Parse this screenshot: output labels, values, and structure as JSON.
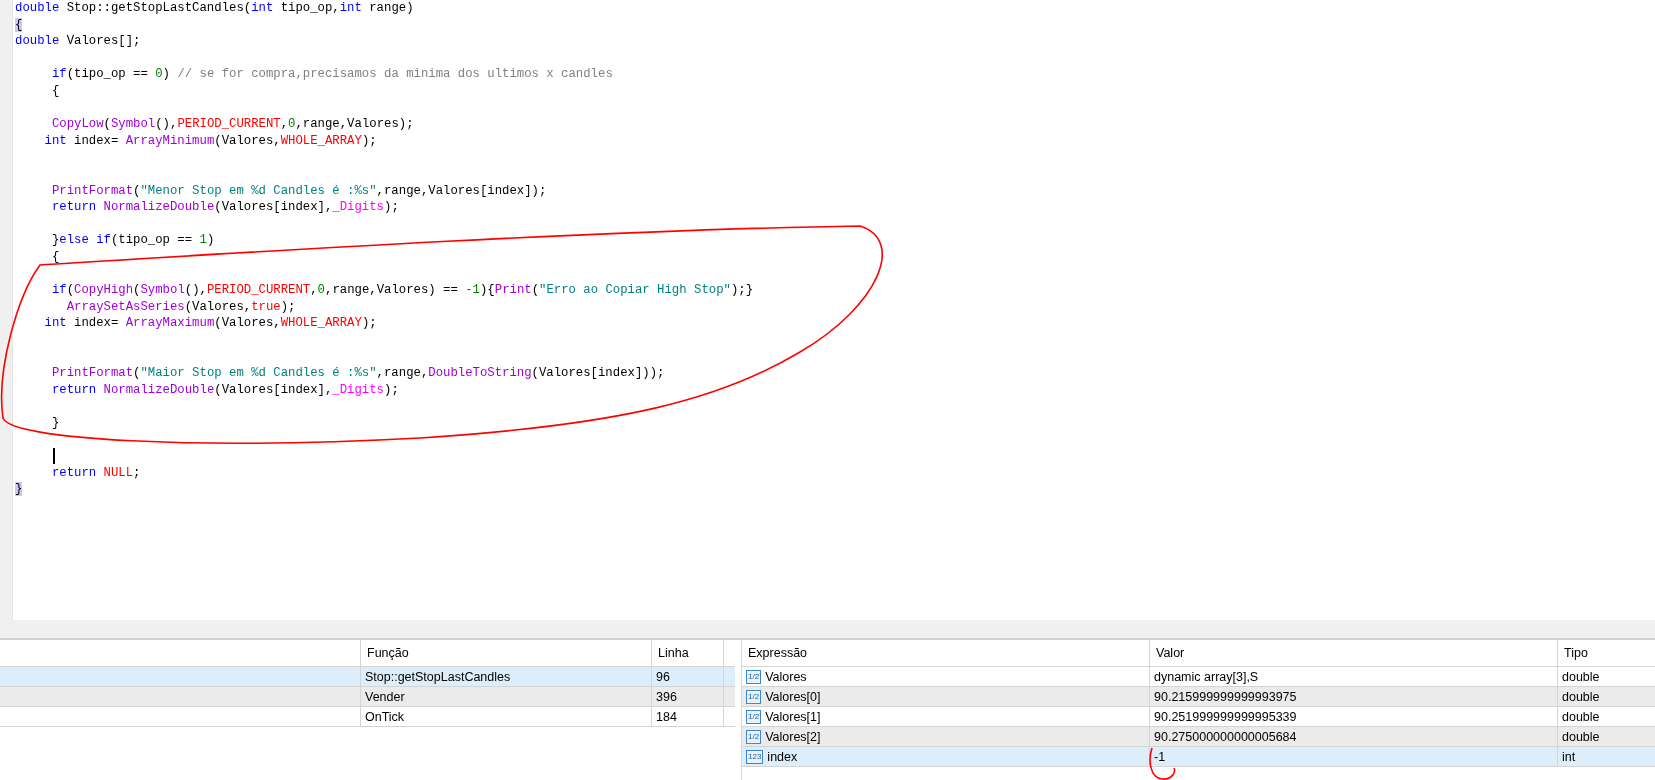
{
  "editor": {
    "lines": [
      {
        "tokens": [
          {
            "kind": "kw",
            "text": "double"
          },
          {
            "kind": "plain",
            "text": " Stop::getStopLastCandles("
          },
          {
            "kind": "kw",
            "text": "int"
          },
          {
            "kind": "plain",
            "text": " tipo_op,"
          },
          {
            "kind": "kw",
            "text": "int"
          },
          {
            "kind": "plain",
            "text": " range)"
          }
        ]
      },
      {
        "tokens": [
          {
            "kind": "brace",
            "text": "{"
          }
        ]
      },
      {
        "tokens": [
          {
            "kind": "kw",
            "text": "double"
          },
          {
            "kind": "plain",
            "text": " Valores[];"
          }
        ]
      },
      {
        "kind": "blank"
      },
      {
        "tokens": [
          {
            "kind": "kw",
            "text": "     if"
          },
          {
            "kind": "plain",
            "text": "(tipo_op == "
          },
          {
            "kind": "num",
            "text": "0"
          },
          {
            "kind": "plain",
            "text": ") "
          },
          {
            "kind": "comment",
            "text": "// se for compra,precisamos da minima dos ultimos x candles"
          }
        ]
      },
      {
        "tokens": [
          {
            "kind": "plain",
            "text": "     {"
          }
        ]
      },
      {
        "kind": "blank"
      },
      {
        "tokens": [
          {
            "kind": "fn",
            "text": "     CopyLow"
          },
          {
            "kind": "plain",
            "text": "("
          },
          {
            "kind": "fn",
            "text": "Symbol"
          },
          {
            "kind": "plain",
            "text": "(),"
          },
          {
            "kind": "const",
            "text": "PERIOD_CURRENT"
          },
          {
            "kind": "plain",
            "text": ","
          },
          {
            "kind": "num",
            "text": "0"
          },
          {
            "kind": "plain",
            "text": ",range,Valores);"
          }
        ]
      },
      {
        "tokens": [
          {
            "kind": "kw",
            "text": "    int"
          },
          {
            "kind": "plain",
            "text": " index= "
          },
          {
            "kind": "fn",
            "text": "ArrayMinimum"
          },
          {
            "kind": "plain",
            "text": "(Valores,"
          },
          {
            "kind": "const",
            "text": "WHOLE_ARRAY"
          },
          {
            "kind": "plain",
            "text": ");"
          }
        ]
      },
      {
        "kind": "blank"
      },
      {
        "kind": "blank"
      },
      {
        "tokens": [
          {
            "kind": "fn",
            "text": "     PrintFormat"
          },
          {
            "kind": "plain",
            "text": "("
          },
          {
            "kind": "str",
            "text": "\"Menor Stop em %d Candles é :%s\""
          },
          {
            "kind": "plain",
            "text": ",range,Valores[index]);"
          }
        ]
      },
      {
        "tokens": [
          {
            "kind": "kw",
            "text": "     return"
          },
          {
            "kind": "fn",
            "text": " NormalizeDouble"
          },
          {
            "kind": "plain",
            "text": "(Valores[index],"
          },
          {
            "kind": "var",
            "text": "_Digits"
          },
          {
            "kind": "plain",
            "text": ");"
          }
        ]
      },
      {
        "kind": "blank"
      },
      {
        "tokens": [
          {
            "kind": "plain",
            "text": "     }"
          },
          {
            "kind": "kw",
            "text": "else if"
          },
          {
            "kind": "plain",
            "text": "(tipo_op == "
          },
          {
            "kind": "num",
            "text": "1"
          },
          {
            "kind": "plain",
            "text": ")"
          }
        ]
      },
      {
        "tokens": [
          {
            "kind": "plain",
            "text": "     {"
          }
        ]
      },
      {
        "kind": "blank"
      },
      {
        "tokens": [
          {
            "kind": "kw",
            "text": "     if"
          },
          {
            "kind": "plain",
            "text": "("
          },
          {
            "kind": "fn",
            "text": "CopyHigh"
          },
          {
            "kind": "plain",
            "text": "("
          },
          {
            "kind": "fn",
            "text": "Symbol"
          },
          {
            "kind": "plain",
            "text": "(),"
          },
          {
            "kind": "const",
            "text": "PERIOD_CURRENT"
          },
          {
            "kind": "plain",
            "text": ","
          },
          {
            "kind": "num",
            "text": "0"
          },
          {
            "kind": "plain",
            "text": ",range,Valores) == "
          },
          {
            "kind": "num",
            "text": "-1"
          },
          {
            "kind": "plain",
            "text": "){"
          },
          {
            "kind": "fn",
            "text": "Print"
          },
          {
            "kind": "plain",
            "text": "("
          },
          {
            "kind": "str",
            "text": "\"Erro ao Copiar High Stop\""
          },
          {
            "kind": "plain",
            "text": ");}"
          }
        ]
      },
      {
        "tokens": [
          {
            "kind": "fn",
            "text": "       ArraySetAsSeries"
          },
          {
            "kind": "plain",
            "text": "(Valores,"
          },
          {
            "kind": "const",
            "text": "true"
          },
          {
            "kind": "plain",
            "text": ");"
          }
        ]
      },
      {
        "tokens": [
          {
            "kind": "kw",
            "text": "    int"
          },
          {
            "kind": "plain",
            "text": " index= "
          },
          {
            "kind": "fn",
            "text": "ArrayMaximum"
          },
          {
            "kind": "plain",
            "text": "(Valores,"
          },
          {
            "kind": "const",
            "text": "WHOLE_ARRAY"
          },
          {
            "kind": "plain",
            "text": ");"
          }
        ]
      },
      {
        "kind": "blank"
      },
      {
        "kind": "blank"
      },
      {
        "tokens": [
          {
            "kind": "fn",
            "text": "     PrintFormat"
          },
          {
            "kind": "plain",
            "text": "("
          },
          {
            "kind": "str",
            "text": "\"Maior Stop em %d Candles é :%s\""
          },
          {
            "kind": "plain",
            "text": ",range,"
          },
          {
            "kind": "fn",
            "text": "DoubleToString"
          },
          {
            "kind": "plain",
            "text": "(Valores[index]));"
          }
        ]
      },
      {
        "tokens": [
          {
            "kind": "kw",
            "text": "     return"
          },
          {
            "kind": "fn",
            "text": " NormalizeDouble"
          },
          {
            "kind": "plain",
            "text": "(Valores[index],"
          },
          {
            "kind": "var",
            "text": "_Digits"
          },
          {
            "kind": "plain",
            "text": ");"
          }
        ]
      },
      {
        "kind": "blank"
      },
      {
        "tokens": [
          {
            "kind": "plain",
            "text": "     }"
          }
        ]
      },
      {
        "kind": "blank"
      },
      {
        "kind": "cursor"
      },
      {
        "tokens": [
          {
            "kind": "kw",
            "text": "     return"
          },
          {
            "kind": "const",
            "text": " NULL"
          },
          {
            "kind": "plain",
            "text": ";"
          }
        ]
      },
      {
        "tokens": [
          {
            "kind": "brace",
            "text": "}"
          }
        ]
      }
    ]
  },
  "call_stack": {
    "columns": [
      "Função",
      "Linha"
    ],
    "rows": [
      {
        "function": "Stop::getStopLastCandles",
        "line": "96",
        "selected": true
      },
      {
        "function": "Vender",
        "line": "396",
        "selected": false
      },
      {
        "function": "OnTick",
        "line": "184",
        "selected": false
      }
    ]
  },
  "watch": {
    "columns": [
      "Expressão",
      "Valor",
      "Tipo"
    ],
    "rows": [
      {
        "icon": "1/2",
        "expression": "Valores",
        "value": "dynamic array[3],S",
        "type": "double",
        "selected": false
      },
      {
        "icon": "1/2",
        "expression": "Valores[0]",
        "value": "90.215999999999993975",
        "type": "double",
        "selected": false
      },
      {
        "icon": "1/2",
        "expression": "Valores[1]",
        "value": "90.251999999999995339",
        "type": "double",
        "selected": false
      },
      {
        "icon": "1/2",
        "expression": "Valores[2]",
        "value": "90.275000000000005684",
        "type": "double",
        "selected": false
      },
      {
        "icon": "123",
        "expression": "index",
        "value": "-1",
        "type": "int",
        "selected": true
      }
    ]
  }
}
